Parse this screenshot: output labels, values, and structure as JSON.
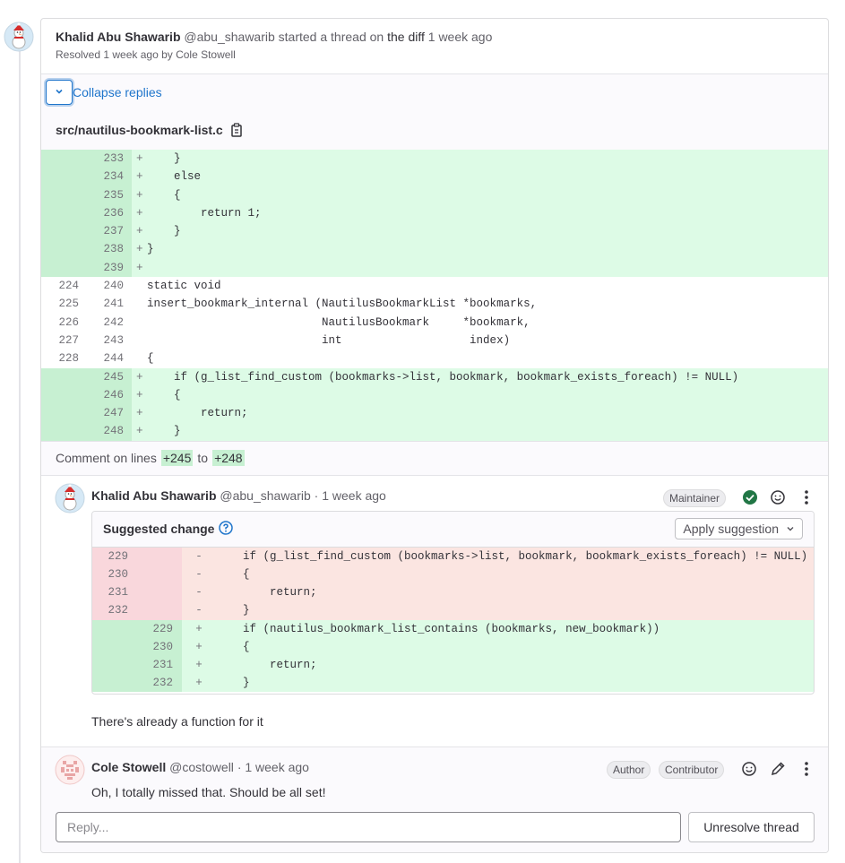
{
  "thread": {
    "author_name": "Khalid Abu Shawarib",
    "author_handle": "@abu_shawarib",
    "started_text": "started a thread on",
    "diff_link": "the diff",
    "time": "1 week ago",
    "resolved_text": "Resolved 1 week ago by Cole Stowell",
    "collapse_label": "Collapse replies",
    "file_name": "src/nautilus-bookmark-list.c",
    "comment_on_prefix": "Comment on lines",
    "comment_on_from": "+245",
    "comment_on_to_word": "to",
    "comment_on_to": "+248"
  },
  "diff_lines": [
    {
      "old": "",
      "new": "233",
      "type": "added",
      "code": "    }"
    },
    {
      "old": "",
      "new": "234",
      "type": "added",
      "code": "    else"
    },
    {
      "old": "",
      "new": "235",
      "type": "added",
      "code": "    {"
    },
    {
      "old": "",
      "new": "236",
      "type": "added",
      "code": "        return 1;"
    },
    {
      "old": "",
      "new": "237",
      "type": "added",
      "code": "    }"
    },
    {
      "old": "",
      "new": "238",
      "type": "added",
      "code": "}"
    },
    {
      "old": "",
      "new": "239",
      "type": "added",
      "code": ""
    },
    {
      "old": "224",
      "new": "240",
      "type": "context",
      "code": "static void"
    },
    {
      "old": "225",
      "new": "241",
      "type": "context",
      "code": "insert_bookmark_internal (NautilusBookmarkList *bookmarks,"
    },
    {
      "old": "226",
      "new": "242",
      "type": "context",
      "code": "                          NautilusBookmark     *bookmark,"
    },
    {
      "old": "227",
      "new": "243",
      "type": "context",
      "code": "                          int                   index)"
    },
    {
      "old": "228",
      "new": "244",
      "type": "context",
      "code": "{"
    },
    {
      "old": "",
      "new": "245",
      "type": "added",
      "code": "    if (g_list_find_custom (bookmarks->list, bookmark, bookmark_exists_foreach) != NULL)"
    },
    {
      "old": "",
      "new": "246",
      "type": "added",
      "code": "    {"
    },
    {
      "old": "",
      "new": "247",
      "type": "added",
      "code": "        return;"
    },
    {
      "old": "",
      "new": "248",
      "type": "added",
      "code": "    }"
    }
  ],
  "note1": {
    "author_name": "Khalid Abu Shawarib",
    "author_handle": "@abu_shawarib",
    "time": "· 1 week ago",
    "role_badge": "Maintainer",
    "suggestion_title": "Suggested change",
    "apply_label": "Apply suggestion",
    "body": "There's already a function for it",
    "suggestion_lines": [
      {
        "old": "229",
        "new": "",
        "sign": "-",
        "type": "removed",
        "code": "    if (g_list_find_custom (bookmarks->list, bookmark, bookmark_exists_foreach) != NULL)"
      },
      {
        "old": "230",
        "new": "",
        "sign": "-",
        "type": "removed",
        "code": "    {"
      },
      {
        "old": "231",
        "new": "",
        "sign": "-",
        "type": "removed",
        "code": "        return;"
      },
      {
        "old": "232",
        "new": "",
        "sign": "-",
        "type": "removed",
        "code": "    }"
      },
      {
        "old": "",
        "new": "229",
        "sign": "+",
        "type": "added",
        "code": "    if (nautilus_bookmark_list_contains (bookmarks, new_bookmark))"
      },
      {
        "old": "",
        "new": "230",
        "sign": "+",
        "type": "added",
        "code": "    {"
      },
      {
        "old": "",
        "new": "231",
        "sign": "+",
        "type": "added",
        "code": "        return;"
      },
      {
        "old": "",
        "new": "232",
        "sign": "+",
        "type": "added",
        "code": "    }"
      }
    ]
  },
  "note2": {
    "author_name": "Cole Stowell",
    "author_handle": "@costowell",
    "time": "· 1 week ago",
    "badge_author": "Author",
    "badge_contributor": "Contributor",
    "body": "Oh, I totally missed that. Should be all set!"
  },
  "reply": {
    "placeholder": "Reply...",
    "unresolve_label": "Unresolve thread"
  },
  "colors": {
    "added_bg": "#ddfbe6",
    "removed_bg": "#fbe5e1",
    "link": "#1f75cb",
    "resolved_check": "#217645"
  }
}
